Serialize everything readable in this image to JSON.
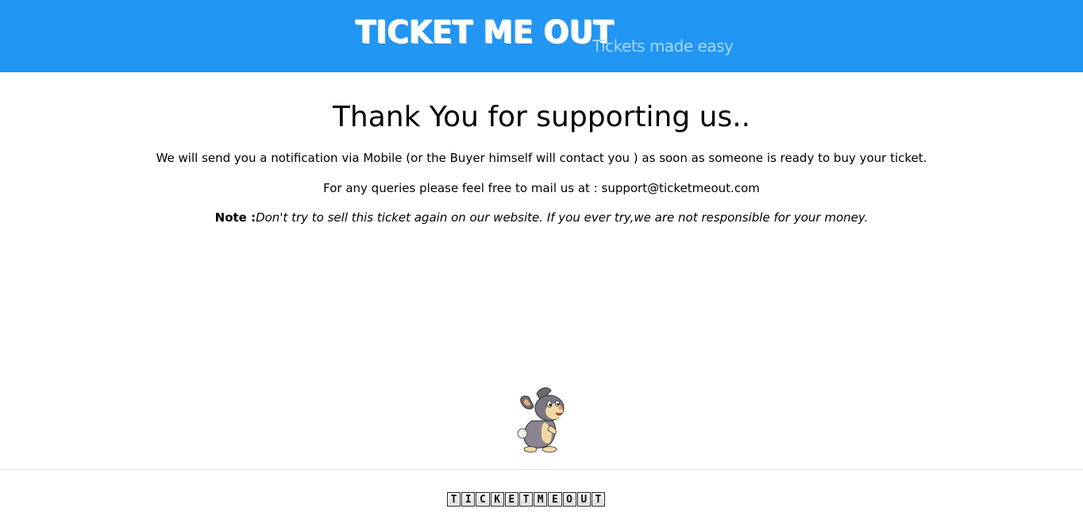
{
  "header": {
    "brand_title": "TICKET ME OUT",
    "tagline": "Tickets made easy",
    "background_color": "#2196f3"
  },
  "main": {
    "heading": "Thank You for supporting us..",
    "notification_text": "We will send you a notification via Mobile (or the Buyer himself will contact you ) as soon as someone is ready to buy your ticket.",
    "queries_text": "For any queries please feel free to mail us at : support@ticketmeout.com",
    "note_label": "Note :",
    "note_text": "Don't try to sell this ticket again on our website. If you ever try,we are not responsible for your money."
  },
  "mascot": {
    "icon": "rabbit-mascot-icon"
  },
  "footer": {
    "logo_letters": [
      "T",
      "I",
      "C",
      "K",
      "E",
      "T",
      "M",
      "E",
      "O",
      "U",
      "T"
    ]
  }
}
